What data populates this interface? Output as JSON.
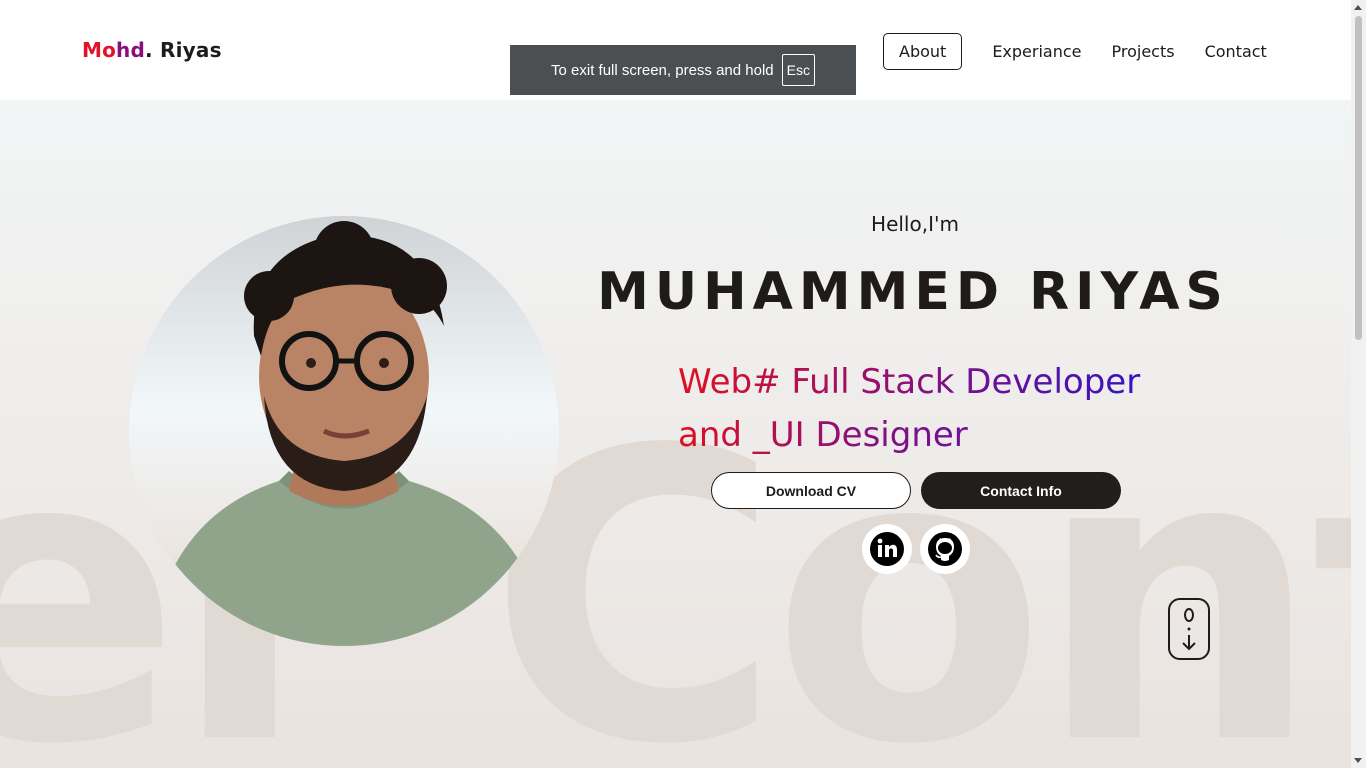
{
  "logo": {
    "part1": "Mo",
    "part2": "hd",
    "part3": ". Riyas"
  },
  "nav": {
    "items": [
      {
        "label": "About",
        "active": true
      },
      {
        "label": "Experiance",
        "active": false
      },
      {
        "label": "Projects",
        "active": false
      },
      {
        "label": "Contact",
        "active": false
      }
    ]
  },
  "fullscreen_toast": {
    "message": "To exit full screen, press and hold",
    "key": "Esc"
  },
  "hero": {
    "greeting": "Hello,I'm",
    "name": "MUHAMMED RIYAS",
    "role_line1": "Web# Full Stack Developer",
    "role_line2": "and _UI Designer",
    "background_text": "er Cont",
    "download_cv_label": "Download CV",
    "contact_info_label": "Contact Info"
  },
  "social": {
    "linkedin_icon": "linkedin-icon",
    "github_icon": "github-icon"
  },
  "colors": {
    "accent_red": "#e0101f",
    "accent_purple": "#8a0f7c",
    "accent_blue": "#1d13d6",
    "dark": "#221e1b"
  }
}
